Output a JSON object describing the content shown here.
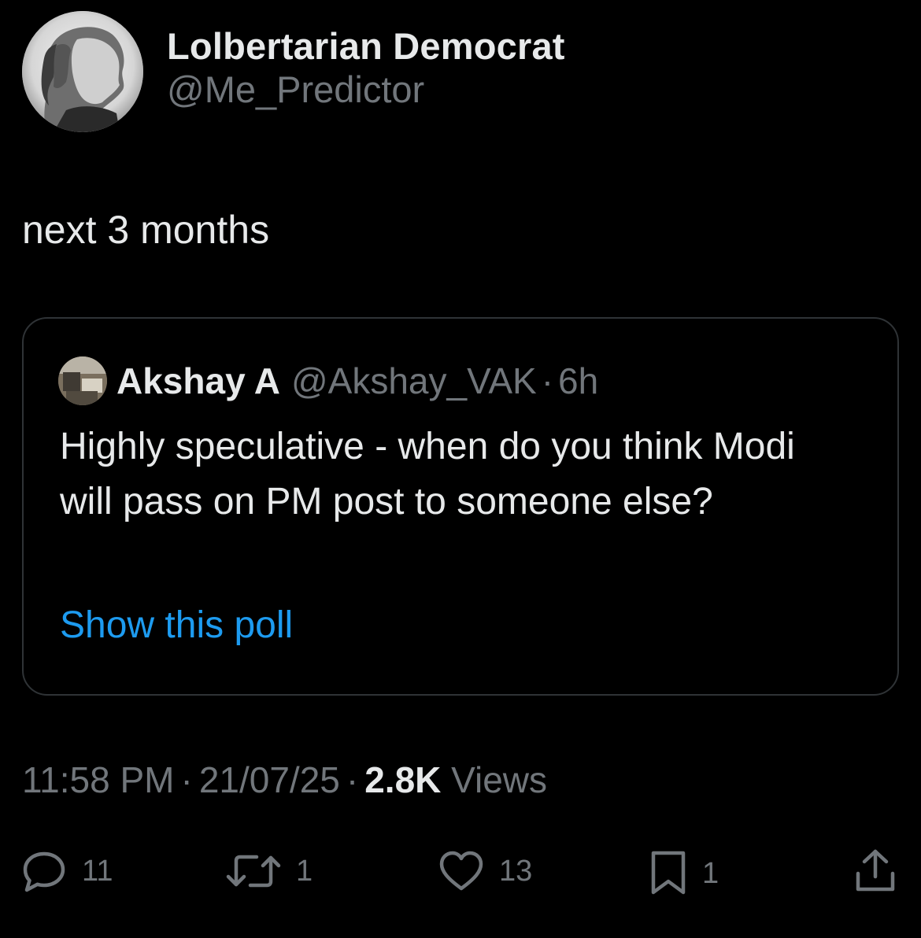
{
  "author": {
    "display_name": "Lolbertarian Democrat",
    "handle": "@Me_Predictor"
  },
  "tweet": {
    "text": "next 3 months"
  },
  "quoted": {
    "name": "Akshay A",
    "handle": "@Akshay_VAK",
    "separator": "·",
    "time": "6h",
    "text": "Highly speculative - when do you think Modi will pass on PM post to someone else?",
    "poll_link": "Show this poll"
  },
  "meta": {
    "time": "11:58 PM",
    "date": "21/07/25",
    "separator": "·",
    "views_count": "2.8K",
    "views_label": "Views"
  },
  "actions": {
    "replies": "11",
    "retweets": "1",
    "likes": "13",
    "bookmarks": "1"
  },
  "colors": {
    "background": "#000000",
    "text_primary": "#e7e9ea",
    "text_secondary": "#71767b",
    "link": "#1d9bf0",
    "border": "#2f3336"
  },
  "icons": [
    "reply-icon",
    "retweet-icon",
    "like-icon",
    "bookmark-icon",
    "share-icon"
  ]
}
